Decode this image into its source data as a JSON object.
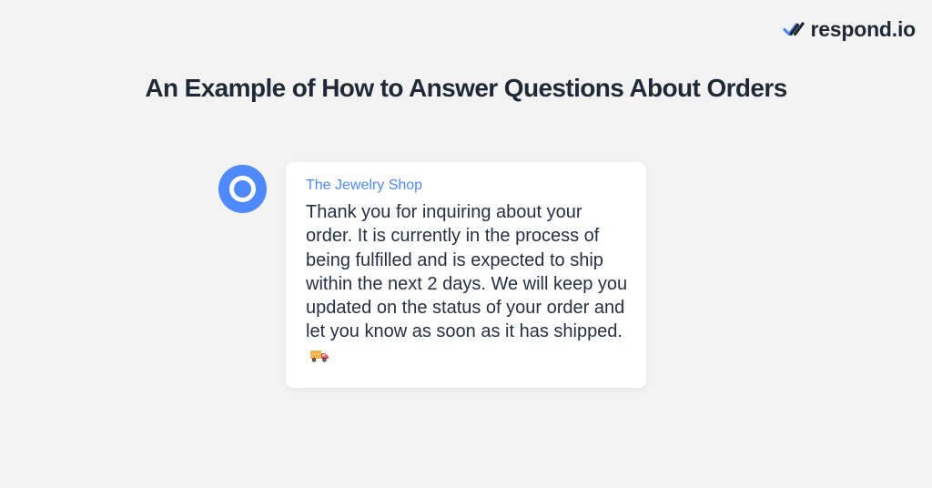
{
  "brand": {
    "name": "respond.io",
    "mark_icon": "check-mark-logo-icon"
  },
  "header": {
    "title": "An Example of How to Answer Questions About Orders"
  },
  "chat": {
    "avatar_icon": "ring-avatar-icon",
    "sender": "The Jewelry Shop",
    "message": "Thank you for inquiring about your order. It is currently in the process of being fulfilled and is expected to ship within the next 2 days. We will keep you updated on the status of your order and let you know as soon as it has shipped.",
    "emoji_icon": "delivery-truck-icon"
  },
  "colors": {
    "background": "#f3f3f4",
    "accent": "#4e89ff",
    "heading": "#1f2937",
    "body_text": "#243044",
    "card": "#ffffff"
  }
}
